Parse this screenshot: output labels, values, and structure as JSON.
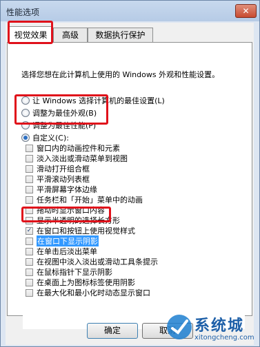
{
  "window": {
    "title": "性能选项",
    "close_label": "✕"
  },
  "tabs": [
    {
      "label": "视觉效果",
      "active": true
    },
    {
      "label": "高级",
      "active": false
    },
    {
      "label": "数据执行保护",
      "active": false
    }
  ],
  "description": "选择您想在此计算机上使用的 Windows 外观和性能设置。",
  "radios": [
    {
      "label": "让 Windows 选择计算机的最佳设置(L)",
      "checked": false
    },
    {
      "label": "调整为最佳外观(B)",
      "checked": false
    },
    {
      "label": "调整为最佳性能(P)",
      "checked": false
    },
    {
      "label": "自定义(C):",
      "checked": true
    }
  ],
  "options": [
    {
      "label": "窗口内的动画控件和元素",
      "checked": false
    },
    {
      "label": "淡入淡出或滑动菜单到视图",
      "checked": false
    },
    {
      "label": "滑动打开组合框",
      "checked": false
    },
    {
      "label": "平滑滚动列表框",
      "checked": false
    },
    {
      "label": "平滑屏幕字体边缘",
      "checked": false
    },
    {
      "label": "任务栏和「开始」菜单中的动画",
      "checked": false
    },
    {
      "label": "拖动时显示窗口内容",
      "checked": false
    },
    {
      "label": "显示半透明的选择长方形",
      "checked": false
    },
    {
      "label": "在窗口和按钮上使用视觉样式",
      "checked": true
    },
    {
      "label": "在窗口下显示阴影",
      "checked": false,
      "selected": true
    },
    {
      "label": "在单击后淡出菜单",
      "checked": false
    },
    {
      "label": "在视图中淡入淡出或滑动工具条提示",
      "checked": false
    },
    {
      "label": "在鼠标指针下显示阴影",
      "checked": false
    },
    {
      "label": "在桌面上为图标标签使用阴影",
      "checked": false
    },
    {
      "label": "在最大化和最小化时动态显示窗口",
      "checked": false
    }
  ],
  "buttons": {
    "ok": "确定",
    "cancel": "取消"
  },
  "watermark": {
    "text": "系统城",
    "url": "xitongcheng.com"
  },
  "colors": {
    "annotation_red": "#e0101a",
    "selection_blue": "#3399ff",
    "accent": "#2c6fc2"
  }
}
